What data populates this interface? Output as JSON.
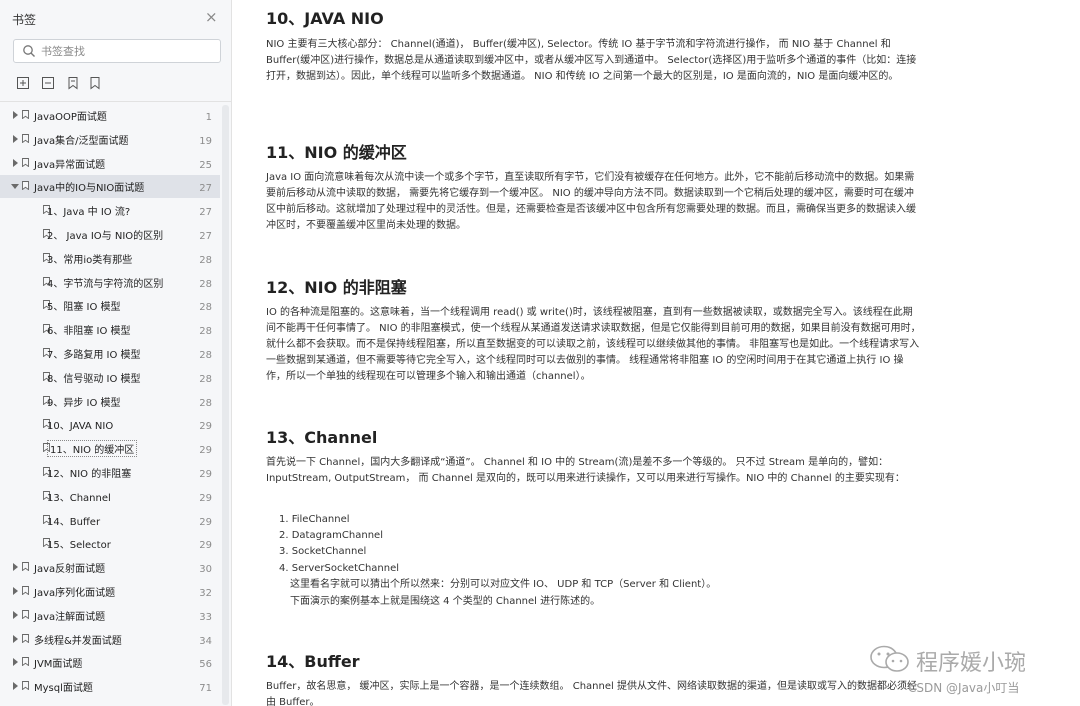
{
  "sidebar": {
    "title": "书签",
    "close_glyph": "×",
    "search_placeholder": "书签查找",
    "tools": [
      "expand-all-icon",
      "collapse-all-icon",
      "bookmark-icon",
      "bookmark-outline-icon"
    ],
    "items": [
      {
        "label": "JavaOOP面试题",
        "page": "1",
        "level": 0,
        "arrow": "right"
      },
      {
        "label": "Java集合/泛型面试题",
        "page": "19",
        "level": 0,
        "arrow": "right"
      },
      {
        "label": "Java异常面试题",
        "page": "25",
        "level": 0,
        "arrow": "right"
      },
      {
        "label": "Java中的IO与NIO面试题",
        "page": "27",
        "level": 0,
        "arrow": "down",
        "selected": true
      },
      {
        "label": "1、Java 中 IO 流?",
        "page": "27",
        "level": 1
      },
      {
        "label": "2、 Java IO与 NIO的区别",
        "page": "27",
        "level": 1
      },
      {
        "label": "3、常用io类有那些",
        "page": "28",
        "level": 1
      },
      {
        "label": "4、字节流与字符流的区别",
        "page": "28",
        "level": 1
      },
      {
        "label": "5、阻塞 IO 模型",
        "page": "28",
        "level": 1
      },
      {
        "label": "6、非阻塞 IO 模型",
        "page": "28",
        "level": 1
      },
      {
        "label": "7、多路复用 IO 模型",
        "page": "28",
        "level": 1
      },
      {
        "label": "8、信号驱动 IO 模型",
        "page": "28",
        "level": 1
      },
      {
        "label": "9、异步 IO 模型",
        "page": "28",
        "level": 1
      },
      {
        "label": "10、JAVA NIO",
        "page": "29",
        "level": 1
      },
      {
        "label": "11、NIO 的缓冲区",
        "page": "29",
        "level": 1,
        "boxed": true
      },
      {
        "label": "12、NIO 的非阻塞",
        "page": "29",
        "level": 1
      },
      {
        "label": "13、Channel",
        "page": "29",
        "level": 1
      },
      {
        "label": "14、Buffer",
        "page": "29",
        "level": 1
      },
      {
        "label": "15、Selector",
        "page": "29",
        "level": 1
      },
      {
        "label": "Java反射面试题",
        "page": "30",
        "level": 0,
        "arrow": "right"
      },
      {
        "label": "Java序列化面试题",
        "page": "32",
        "level": 0,
        "arrow": "right"
      },
      {
        "label": "Java注解面试题",
        "page": "33",
        "level": 0,
        "arrow": "right"
      },
      {
        "label": "多线程&并发面试题",
        "page": "34",
        "level": 0,
        "arrow": "right"
      },
      {
        "label": "JVM面试题",
        "page": "56",
        "level": 0,
        "arrow": "right"
      },
      {
        "label": "Mysql面试题",
        "page": "71",
        "level": 0,
        "arrow": "right"
      }
    ]
  },
  "doc": {
    "s10": {
      "heading": "10、JAVA NIO",
      "p1": "NIO 主要有三大核心部分： Channel(通道)， Buffer(缓冲区), Selector。传统 IO 基于字节流和字符流进行操作， 而 NIO 基于 Channel 和 Buffer(缓冲区)进行操作，数据总是从通道读取到缓冲区中，或者从缓冲区写入到通道中。 Selector(选择区)用于监听多个通道的事件（比如：连接打开，数据到达）。因此，单个线程可以监听多个数据通道。 NIO 和传统 IO 之间第一个最大的区别是，IO 是面向流的，NIO 是面向缓冲区的。"
    },
    "s11": {
      "heading": "11、NIO 的缓冲区",
      "p1": "Java IO 面向流意味着每次从流中读一个或多个字节，直至读取所有字节，它们没有被缓存在任何地方。此外，它不能前后移动流中的数据。如果需要前后移动从流中读取的数据， 需要先将它缓存到一个缓冲区。 NIO 的缓冲导向方法不同。数据读取到一个它稍后处理的缓冲区，需要时可在缓冲区中前后移动。这就增加了处理过程中的灵活性。但是，还需要检查是否该缓冲区中包含所有您需要处理的数据。而且，需确保当更多的数据读入缓冲区时，不要覆盖缓冲区里尚未处理的数据。"
    },
    "s12": {
      "heading": "12、NIO 的非阻塞",
      "p1": "IO 的各种流是阻塞的。这意味着，当一个线程调用 read() 或 write()时，该线程被阻塞，直到有一些数据被读取，或数据完全写入。该线程在此期间不能再干任何事情了。 NIO 的非阻塞模式，使一个线程从某通道发送请求读取数据，但是它仅能得到目前可用的数据，如果目前没有数据可用时，就什么都不会获取。而不是保持线程阻塞，所以直至数据变的可以读取之前，该线程可以继续做其他的事情。 非阻塞写也是如此。一个线程请求写入一些数据到某通道，但不需要等待它完全写入，这个线程同时可以去做别的事情。 线程通常将非阻塞 IO 的空闲时间用于在其它通道上执行 IO 操作，所以一个单独的线程现在可以管理多个输入和输出通道（channel）。"
    },
    "s13": {
      "heading": "13、Channel",
      "p1": "首先说一下 Channel，国内大多翻译成“通道”。 Channel 和 IO 中的 Stream(流)是差不多一个等级的。 只不过 Stream 是单向的，譬如：InputStream, OutputStream， 而 Channel 是双向的，既可以用来进行读操作，又可以用来进行写操作。NIO 中的 Channel 的主要实现有：",
      "list": [
        "1. FileChannel",
        "2. DatagramChannel",
        "3. SocketChannel",
        "4. ServerSocketChannel"
      ],
      "note1": "这里看名字就可以猜出个所以然来：分别可以对应文件 IO、 UDP 和 TCP（Server 和 Client）。",
      "note2": "下面演示的案例基本上就是围绕这 4 个类型的 Channel 进行陈述的。"
    },
    "s14": {
      "heading": "14、Buffer",
      "p1": "Buffer，故名思意， 缓冲区，实际上是一个容器，是一个连续数组。 Channel 提供从文件、网络读取数据的渠道，但是读取或写入的数据都必须经由 Buffer。"
    }
  },
  "watermark": {
    "name": "程序媛小琬",
    "csdn": "CSDN @Java小叮当"
  }
}
